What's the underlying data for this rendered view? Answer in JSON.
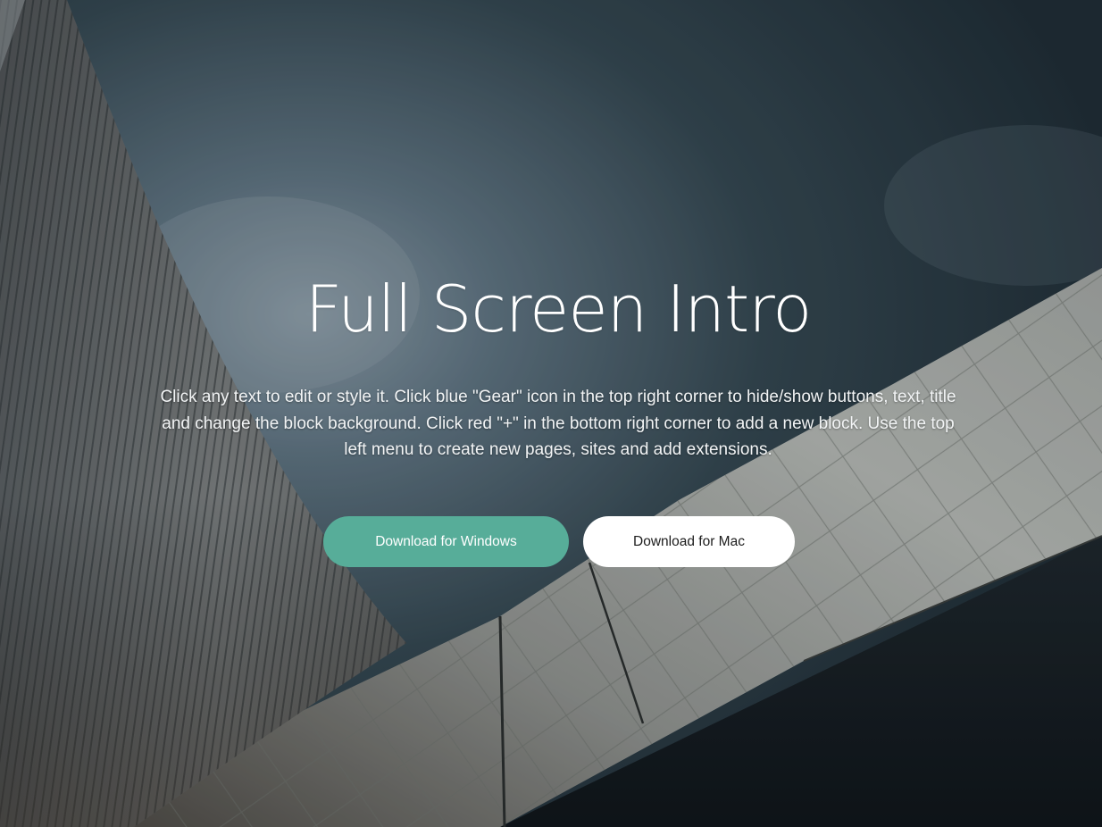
{
  "hero": {
    "title": "Full Screen Intro",
    "description": "Click any text to edit or style it. Click blue \"Gear\" icon in the top right corner to hide/show buttons, text, title and change the block background. Click red \"+\" in the bottom right corner to add a new block. Use the top left menu to create new pages, sites and add extensions.",
    "background_image": "modern-architecture-building-against-dark-cloudy-sky"
  },
  "buttons": {
    "windows_label": "Download for Windows",
    "mac_label": "Download for Mac"
  },
  "colors": {
    "primary_button": "#57ad99",
    "secondary_button": "#ffffff",
    "sky": "#26333c",
    "text": "#ffffff"
  }
}
